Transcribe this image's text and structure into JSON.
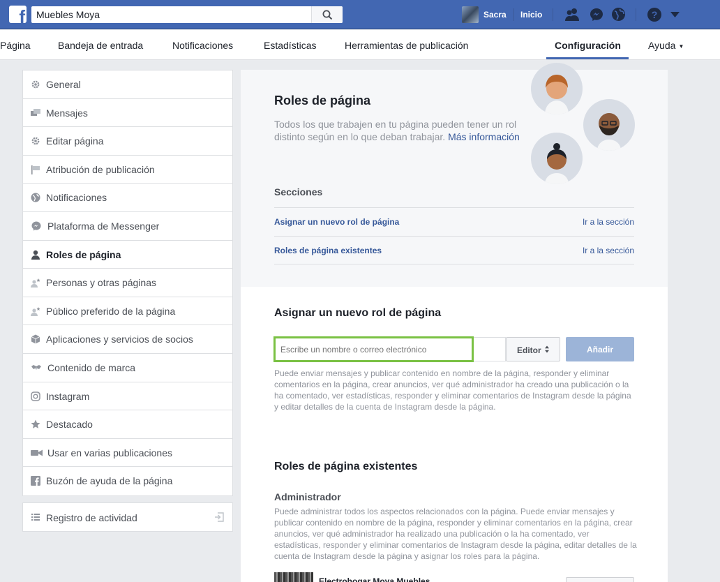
{
  "topbar": {
    "search_value": "Muebles Moya",
    "profile_name": "Sacra",
    "home_label": "Inicio",
    "icons": [
      "friends-icon",
      "messenger-icon",
      "globe-icon",
      "help-icon",
      "caret-down-icon"
    ]
  },
  "tabs": [
    {
      "label": "Página"
    },
    {
      "label": "Bandeja de entrada"
    },
    {
      "label": "Notificaciones"
    },
    {
      "label": "Estadísticas"
    },
    {
      "label": "Herramientas de publicación"
    },
    {
      "label": "Configuración",
      "active": true
    },
    {
      "label": "Ayuda"
    }
  ],
  "sidebar": {
    "items": [
      {
        "label": "General",
        "icon": "gear-icon"
      },
      {
        "label": "Mensajes",
        "icon": "messages-icon"
      },
      {
        "label": "Editar página",
        "icon": "gear-icon"
      },
      {
        "label": "Atribución de publicación",
        "icon": "flag-icon"
      },
      {
        "label": "Notificaciones",
        "icon": "globe-icon"
      },
      {
        "label": "Plataforma de Messenger",
        "icon": "messenger-icon"
      },
      {
        "label": "Roles de página",
        "icon": "person-icon",
        "active": true
      },
      {
        "label": "Personas y otras páginas",
        "icon": "person-star-icon"
      },
      {
        "label": "Público preferido de la página",
        "icon": "person-star-icon"
      },
      {
        "label": "Aplicaciones y servicios de socios",
        "icon": "box-icon"
      },
      {
        "label": "Contenido de marca",
        "icon": "handshake-icon"
      },
      {
        "label": "Instagram",
        "icon": "instagram-icon"
      },
      {
        "label": "Destacado",
        "icon": "star-icon"
      },
      {
        "label": "Usar en varias publicaciones",
        "icon": "video-icon"
      },
      {
        "label": "Buzón de ayuda de la página",
        "icon": "facebook-icon"
      }
    ],
    "activity_log": {
      "label": "Registro de actividad",
      "icon": "list-icon"
    }
  },
  "intro": {
    "title": "Roles de página",
    "description": "Todos los que trabajen en tu página pueden tener un rol distinto según en lo que deban trabajar.",
    "more_link": "Más información",
    "sections_label": "Secciones",
    "sections": [
      {
        "label": "Asignar un nuevo rol de página",
        "go": "Ir a la sección"
      },
      {
        "label": "Roles de página existentes",
        "go": "Ir a la sección"
      }
    ]
  },
  "assign": {
    "title": "Asignar un nuevo rol de página",
    "input_placeholder": "Escribe un nombre o correo electrónico",
    "role_value": "Editor",
    "add_label": "Añadir",
    "help": "Puede enviar mensajes y publicar contenido en nombre de la página, responder y eliminar comentarios en la página, crear anuncios, ver qué administrador ha creado una publicación o la ha comentado, ver estadísticas, responder y eliminar comentarios de Instagram desde la página y editar detalles de la cuenta de Instagram desde la página."
  },
  "existing": {
    "title": "Roles de página existentes",
    "admin_title": "Administrador",
    "admin_desc": "Puede administrar todos los aspectos relacionados con la página. Puede enviar mensajes y publicar contenido en nombre de la página, responder y eliminar comentarios en la página, crear anuncios, ver qué administrador ha realizado una publicación o la ha comentado, ver estadísticas, responder y eliminar comentarios de Instagram desde la página, editar detalles de la cuenta de Instagram desde la página y asignar los roles para la página.",
    "member_name": "Electrohogar Moya Muebles"
  },
  "colors": {
    "brand": "#4267b2",
    "link": "#365899",
    "highlight": "#7ac143",
    "add_button": "#9cb4d8"
  }
}
